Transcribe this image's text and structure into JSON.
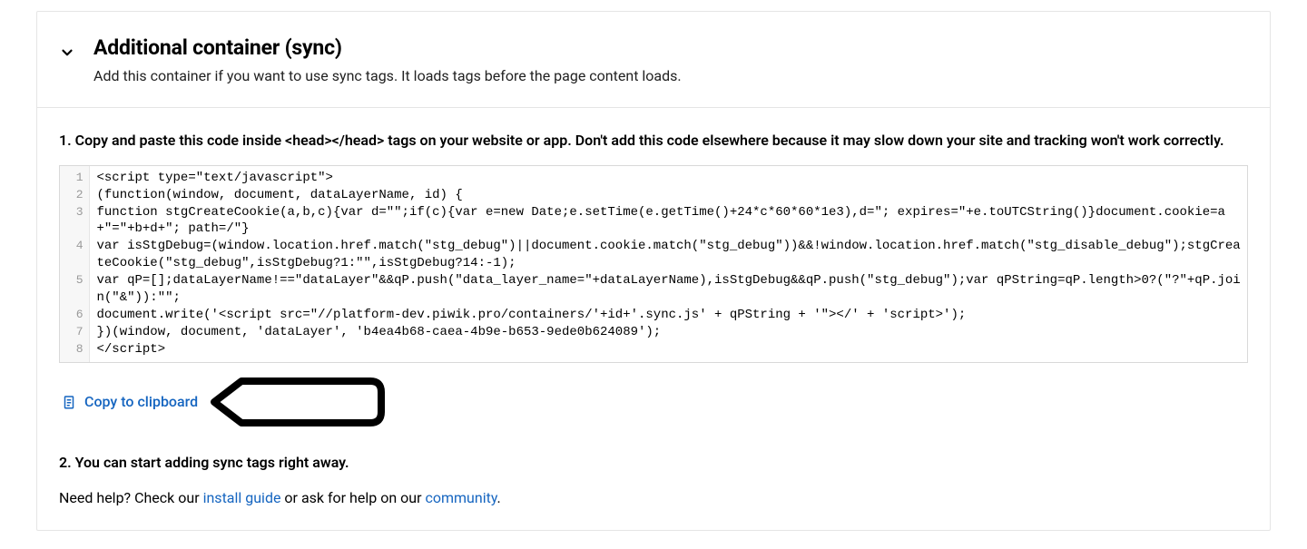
{
  "header": {
    "title": "Additional container (sync)",
    "subtitle": "Add this container if you want to use sync tags. It loads tags before the page content loads."
  },
  "step1_text": "1. Copy and paste this code inside <head></head> tags on your website or app. Don't add this code elsewhere because it may slow down your site and tracking won't work correctly.",
  "code_lines": [
    {
      "n": "1",
      "t": "<script type=\"text/javascript\">"
    },
    {
      "n": "2",
      "t": "(function(window, document, dataLayerName, id) {"
    },
    {
      "n": "3",
      "t": "function stgCreateCookie(a,b,c){var d=\"\";if(c){var e=new Date;e.setTime(e.getTime()+24*c*60*60*1e3),d=\"; expires=\"+e.toUTCString()}document.cookie=a+\"=\"+b+d+\"; path=/\"}"
    },
    {
      "n": "4",
      "t": "var isStgDebug=(window.location.href.match(\"stg_debug\")||document.cookie.match(\"stg_debug\"))&&!window.location.href.match(\"stg_disable_debug\");stgCreateCookie(\"stg_debug\",isStgDebug?1:\"\",isStgDebug?14:-1);"
    },
    {
      "n": "5",
      "t": "var qP=[];dataLayerName!==\"dataLayer\"&&qP.push(\"data_layer_name=\"+dataLayerName),isStgDebug&&qP.push(\"stg_debug\");var qPString=qP.length>0?(\"?\"+qP.join(\"&\")):\"\";"
    },
    {
      "n": "6",
      "t": "document.write('<script src=\"//platform-dev.piwik.pro/containers/'+id+'.sync.js' + qPString + '\"></' + 'script>');"
    },
    {
      "n": "7",
      "t": "})(window, document, 'dataLayer', 'b4ea4b68-caea-4b9e-b653-9ede0b624089');"
    },
    {
      "n": "8",
      "t": "</script>"
    }
  ],
  "copy_label": "Copy to clipboard",
  "step2_text": "2. You can start adding sync tags right away.",
  "help_prefix": "Need help? Check our ",
  "help_link1": "install guide",
  "help_middle": " or ask for help on our ",
  "help_link2": "community",
  "help_suffix": "."
}
